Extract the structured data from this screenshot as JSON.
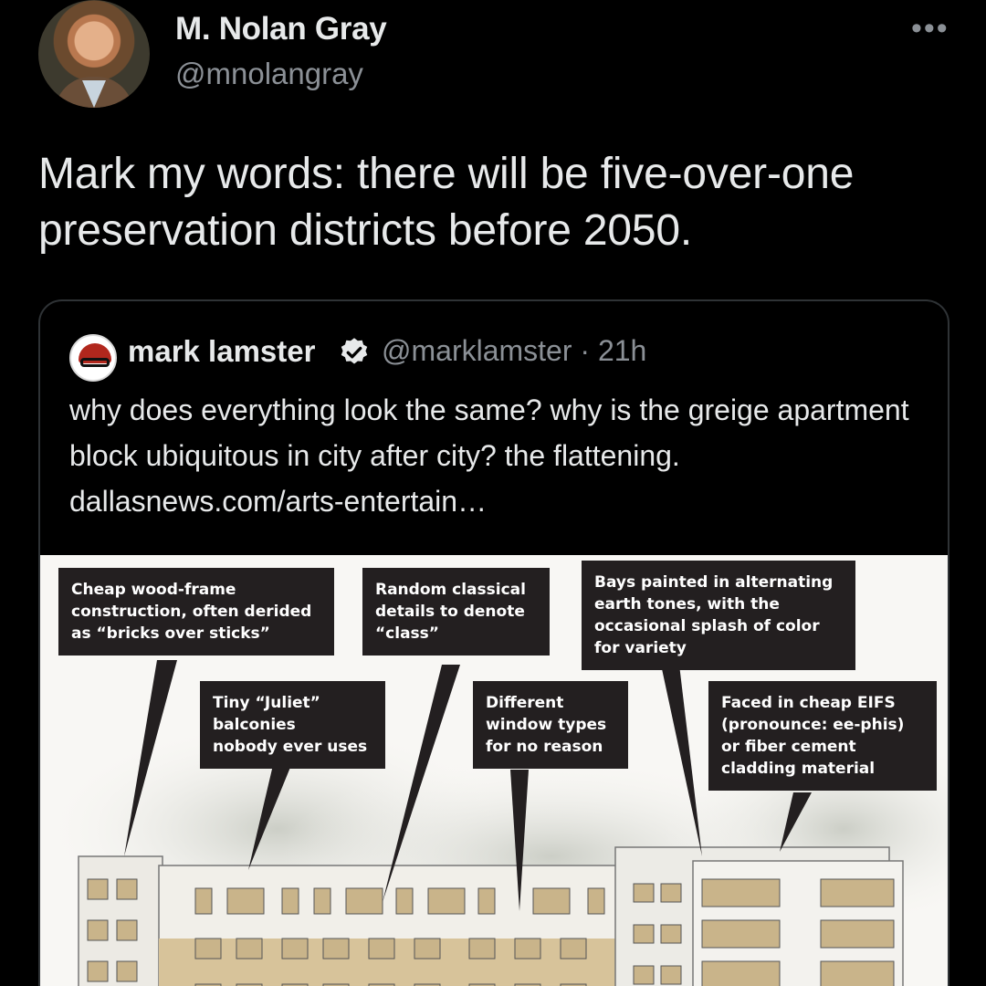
{
  "tweet": {
    "author_name": "M. Nolan Gray",
    "author_handle": "@mnolangray",
    "more_label": "•••",
    "text": "Mark my words: there will be five-over-one preservation districts before 2050."
  },
  "quoted_tweet": {
    "author_name": "mark lamster",
    "handle_time": "@marklamster · 21h",
    "text": "why does everything look the same? why is the greige apartment block ubiquitous in city after city? the flattening. dallasnews.com/arts-entertain…",
    "image_callouts": [
      "Cheap wood-frame\nconstruction, often derided\nas “bricks over sticks”",
      "Random classical\ndetails to denote\n“class”",
      "Bays painted in alternating\nearth tones, with the\noccasional splash of color\nfor variety",
      "Tiny “Juliet”\nbalconies\nnobody ever uses",
      "Different\nwindow types\nfor no reason",
      "Faced in cheap EIFS\n(pronounce: ee-phis)\nor fiber cement\ncladding material"
    ]
  },
  "colors": {
    "background": "#000000",
    "text_primary": "#e7e9ea",
    "text_secondary": "#8b9096",
    "card_border": "#2f3336",
    "callout_bg": "#231f20"
  }
}
